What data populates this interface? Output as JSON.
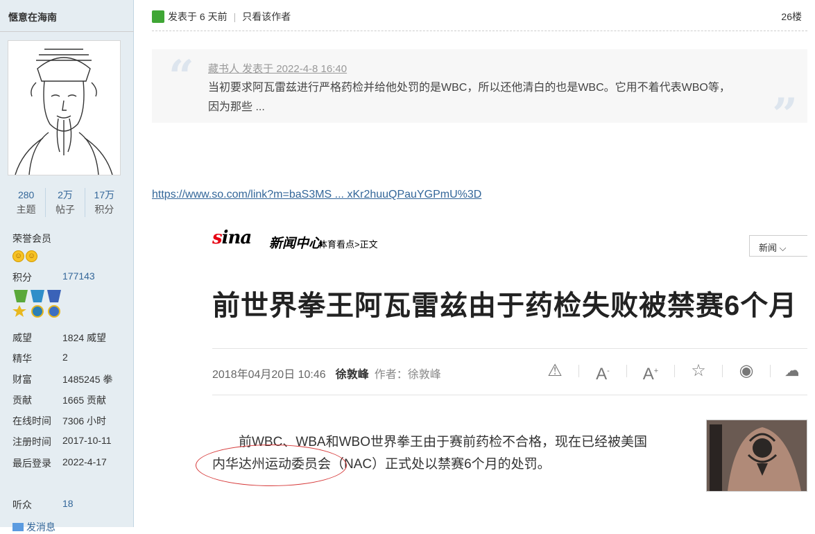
{
  "user": {
    "name": "惬意在海南",
    "stats": [
      {
        "num": "280",
        "label": "主题"
      },
      {
        "num": "2万",
        "label": "帖子"
      },
      {
        "num": "17万",
        "label": "积分"
      }
    ],
    "group": "荣誉会员",
    "points_label": "积分",
    "points_value": "177143",
    "details": [
      {
        "label": "威望",
        "value": "1824 威望"
      },
      {
        "label": "精华",
        "value": "2"
      },
      {
        "label": "财富",
        "value": "1485245 拳"
      },
      {
        "label": "贡献",
        "value": "1665 贡献"
      },
      {
        "label": "在线时间",
        "value": "7306 小时"
      },
      {
        "label": "注册时间",
        "value": "2017-10-11"
      },
      {
        "label": "最后登录",
        "value": "2022-4-17"
      }
    ],
    "listeners_label": "听众",
    "listeners_value": "18",
    "send_message": "发消息"
  },
  "post": {
    "posted": "发表于 6 天前",
    "only_author": "只看该作者",
    "floor": "26楼"
  },
  "quote": {
    "meta": "藏书人 发表于 2022-4-8 16:40",
    "text": "当初要求阿瓦雷兹进行严格药检并给他处罚的是WBC，所以还他清白的也是WBC。它用不着代表WBO等，因为那些 ..."
  },
  "link_text": "https://www.so.com/link?m=baS3MS ... xKr2huuQPauYGPmU%3D",
  "news": {
    "logo": "sina",
    "section": "新闻中心",
    "crumb": "体育看点>正文",
    "nav_button": "新闻",
    "headline": "前世界拳王阿瓦雷兹由于药检失败被禁赛6个月",
    "date": "2018年04月20日 10:46",
    "author": "徐敦峰",
    "byline": "作者：徐敦峰",
    "body_line1": "前WBC、WBA和WBO世界拳王由于赛前药检不合格，现在已经被美国",
    "body_line2": "内华达州运动委员会（NAC）正式处以禁赛6个月的处罚。"
  },
  "colors": {
    "sidebar_bg": "#e5edf2",
    "link": "#336699",
    "highlight_circle": "#d63838"
  }
}
